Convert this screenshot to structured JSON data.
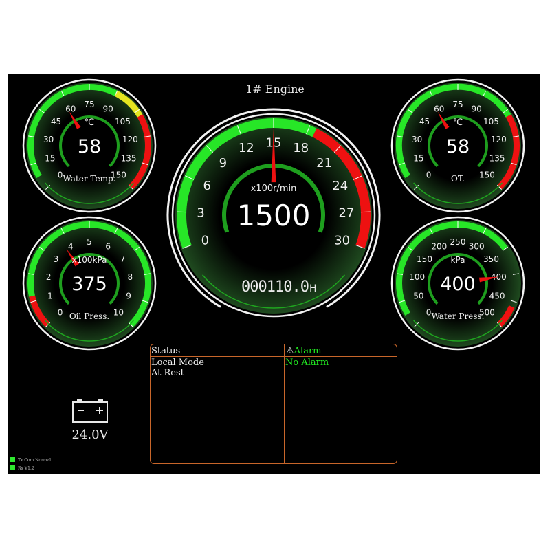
{
  "title": "1# Engine",
  "colors": {
    "green": "#27e627",
    "red": "#ee1111",
    "yellow": "#e5e520",
    "border": "#c8662a"
  },
  "gauges": {
    "water_temp": {
      "label": "Water Temp.",
      "unit": "℃",
      "value_text": "58",
      "value": 58,
      "ticks": [
        "0",
        "15",
        "30",
        "45",
        "60",
        "75",
        "90",
        "105",
        "120",
        "135",
        "150"
      ]
    },
    "oil_press": {
      "label": "Oil Press.",
      "unit": "x100kPa",
      "value_text": "375",
      "value": 3.75,
      "ticks": [
        "0",
        "1",
        "2",
        "3",
        "4",
        "5",
        "6",
        "7",
        "8",
        "9",
        "10"
      ]
    },
    "rpm": {
      "unit": "x100r/min",
      "value_text": "1500",
      "value": 15,
      "ticks": [
        "0",
        "3",
        "6",
        "9",
        "12",
        "15",
        "18",
        "21",
        "24",
        "27",
        "30"
      ],
      "hours": "000110.0",
      "hours_unit": "H"
    },
    "oil_temp": {
      "label": "OT.",
      "unit": "℃",
      "value_text": "58",
      "value": 58,
      "ticks": [
        "0",
        "15",
        "30",
        "45",
        "60",
        "75",
        "90",
        "105",
        "120",
        "135",
        "150"
      ]
    },
    "water_press": {
      "label": "Water Press.",
      "unit": "kPa",
      "value_text": "400",
      "value": 400,
      "ticks": [
        "0",
        "50",
        "100",
        "150",
        "200",
        "250",
        "300",
        "350",
        "400",
        "450",
        "500"
      ]
    }
  },
  "status_panel": {
    "status_header": "Status",
    "alarm_header": "Alarm",
    "status_lines": [
      "Local Mode",
      "At Rest"
    ],
    "alarm_lines": [
      "No Alarm"
    ]
  },
  "battery": {
    "voltage": "24.0V",
    "icon": "battery-icon"
  },
  "comm": {
    "tx": "Tx Com.Normal",
    "rx": "Rx V1.2"
  }
}
